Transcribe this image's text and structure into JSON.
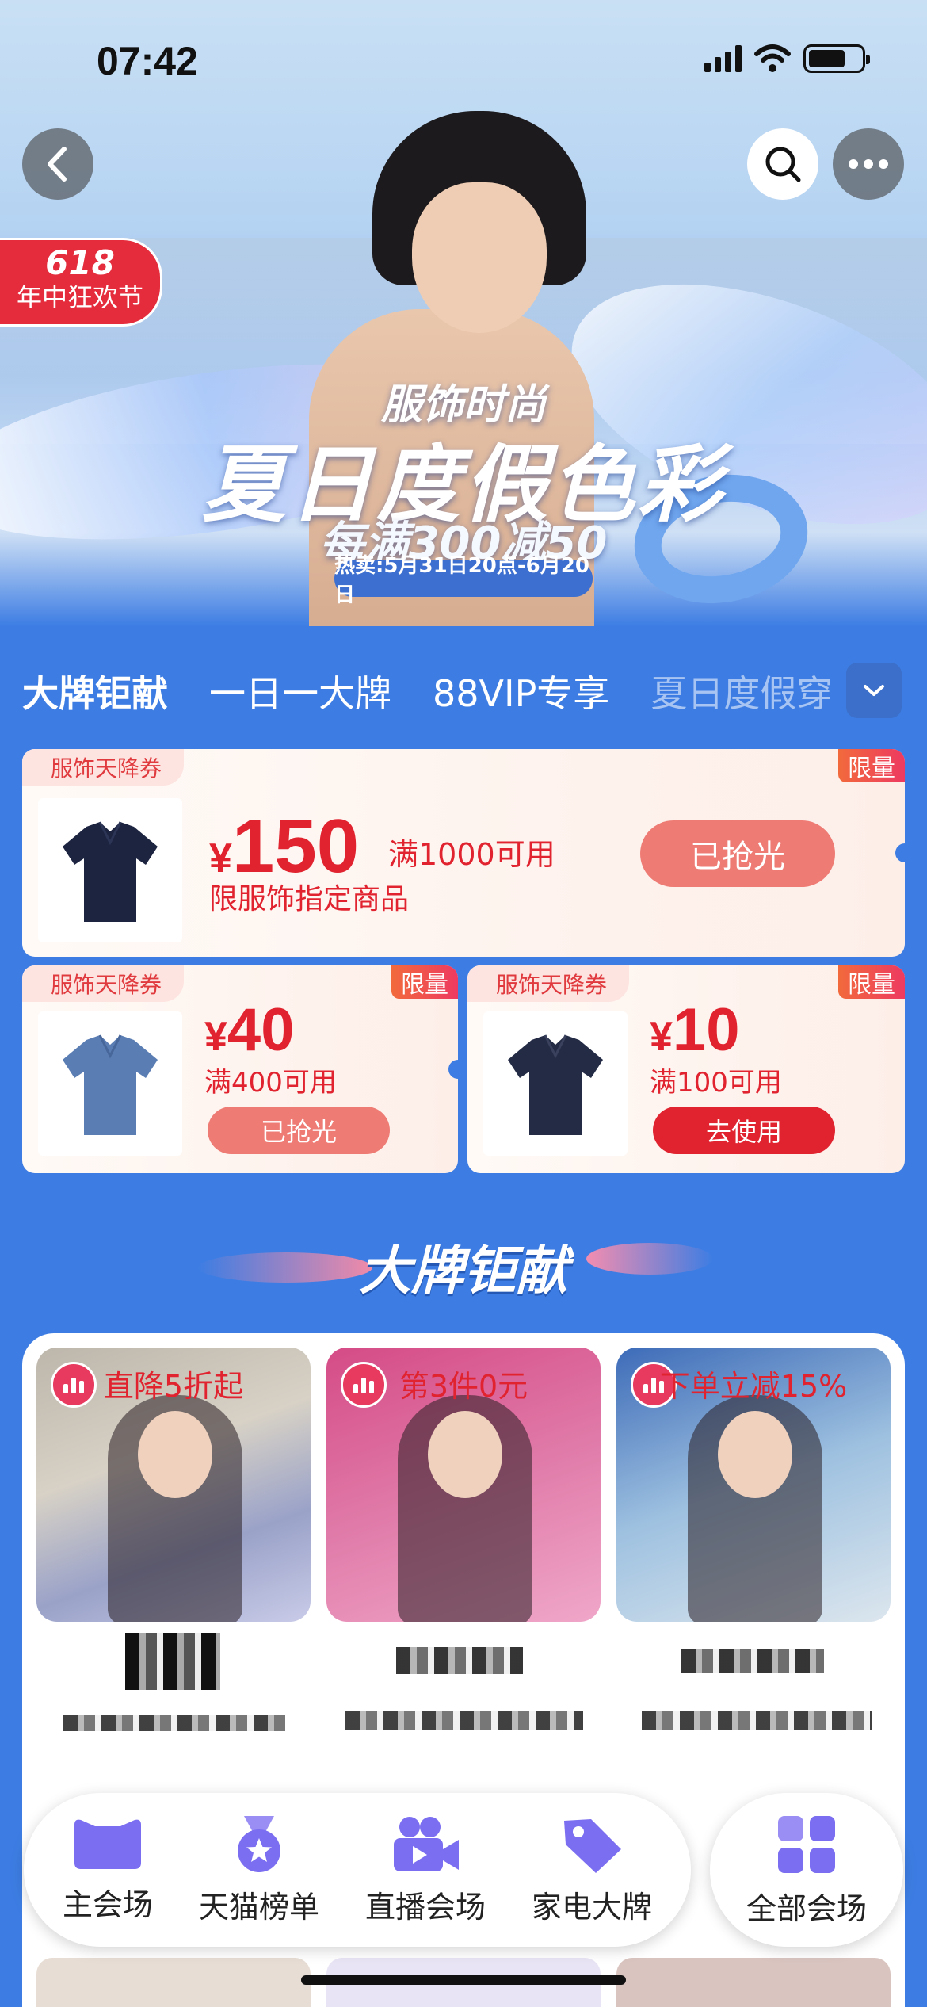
{
  "status_bar": {
    "time": "07:42"
  },
  "hero": {
    "badge_number": "618",
    "badge_text": "年中狂欢节",
    "line1": "服饰时尚",
    "line2": "夏日度假色彩",
    "line3": "每满300减50",
    "date_pill": "热卖:5月31日20点-6月20日"
  },
  "tabs": [
    "大牌钜献",
    "一日一大牌",
    "88VIP专享",
    "夏日度假穿"
  ],
  "coupons": {
    "big": {
      "tag": "服饰天降券",
      "limit": "限量",
      "currency": "¥",
      "amount": "150",
      "condition": "满1000可用",
      "subtitle": "限服饰指定商品",
      "button": "已抢光"
    },
    "small_a": {
      "tag": "服饰天降券",
      "limit": "限量",
      "currency": "¥",
      "amount": "40",
      "condition": "满400可用",
      "button": "已抢光"
    },
    "small_b": {
      "tag": "服饰天降券",
      "limit": "限量",
      "currency": "¥",
      "amount": "10",
      "condition": "满100可用",
      "button": "去使用"
    }
  },
  "section": {
    "title": "大牌钜献"
  },
  "brands": [
    {
      "deal": "直降5折起"
    },
    {
      "deal": "第3件0元"
    },
    {
      "deal": "下单立减15%"
    }
  ],
  "bottom_nav": {
    "items": [
      {
        "label": "主会场",
        "icon": "tmall-cat-icon"
      },
      {
        "label": "天猫榜单",
        "icon": "medal-icon"
      },
      {
        "label": "直播会场",
        "icon": "video-camera-icon"
      },
      {
        "label": "家电大牌",
        "icon": "tag-icon"
      }
    ],
    "all": {
      "label": "全部会场",
      "icon": "grid-icon"
    }
  },
  "colors": {
    "accent_red": "#e0232f",
    "page_blue": "#3d7de3",
    "nav_purple": "#7b6ef0"
  }
}
